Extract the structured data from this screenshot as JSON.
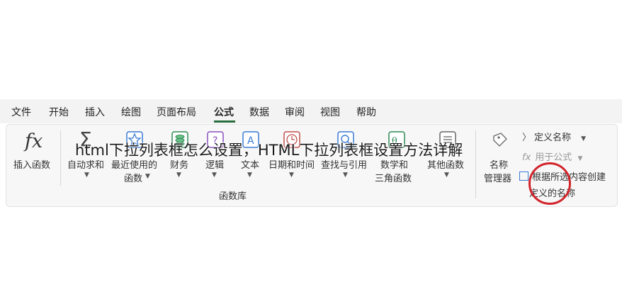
{
  "tabs": [
    {
      "label": "文件"
    },
    {
      "label": "开始"
    },
    {
      "label": "插入"
    },
    {
      "label": "绘图"
    },
    {
      "label": "页面布局"
    },
    {
      "label": "公式"
    },
    {
      "label": "数据"
    },
    {
      "label": "审阅"
    },
    {
      "label": "视图"
    },
    {
      "label": "帮助"
    }
  ],
  "active_tab": "公式",
  "ribbon": {
    "insert_function": {
      "icon_text": "fx",
      "label": "插入函数"
    },
    "autosum": {
      "icon_text": "Σ",
      "label": "自动求和"
    },
    "recent": {
      "label_1": "最近使用的",
      "label_2": "函数"
    },
    "financial": {
      "label": "财务"
    },
    "logical": {
      "label": "逻辑"
    },
    "text": {
      "label": "文本"
    },
    "datetime": {
      "label": "日期和时间"
    },
    "lookup": {
      "label": "查找与引用"
    },
    "math": {
      "label_1": "数学和",
      "label_2": "三角函数"
    },
    "other": {
      "label": "其他函数"
    },
    "group_label": "函数库",
    "name_manager": {
      "label_1": "名称",
      "label_2": "管理器"
    },
    "define_name": {
      "label": "定义名称"
    },
    "use_in_formula": {
      "label": "用于公式"
    },
    "create_from_selection": {
      "label_1": "根据所选内容创建",
      "label_2": "定义的名称"
    }
  },
  "overlay_title": "html下拉列表框怎么设置，HTML下拉列表框设置方法详解",
  "colors": {
    "accent": "#2b6e3f",
    "highlight_circle": "#d2242b"
  }
}
